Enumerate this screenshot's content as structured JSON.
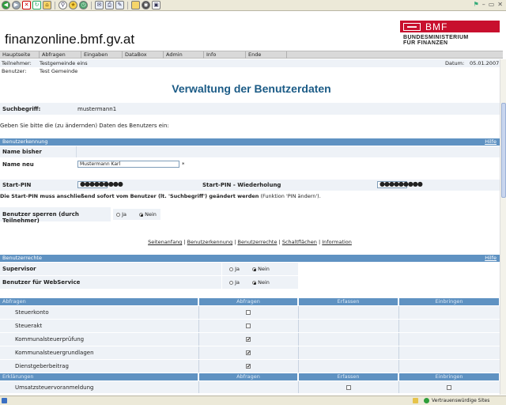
{
  "browser": {
    "toolbar_icons": [
      "back-icon",
      "forward-icon",
      "stop-icon",
      "refresh-icon",
      "home-icon",
      "search-icon",
      "favorites-icon",
      "history-icon",
      "mail-icon",
      "print-icon",
      "edit-icon",
      "folder-icon",
      "media-icon",
      "messenger-icon"
    ],
    "status_text": "Vertrauenswürdige Sites"
  },
  "header": {
    "site_title": "finanzonline.bmf.gv.at",
    "logo_short": "BMF",
    "logo_line1": "BUNDESMINISTERIUM",
    "logo_line2": "FÜR FINANZEN"
  },
  "nav": [
    "Hauptseite",
    "Abfragen",
    "Eingaben",
    "DataBox",
    "Admin",
    "Info",
    "Ende"
  ],
  "info": {
    "teilnehmer_label": "Teilnehmer:",
    "teilnehmer_value": "Testgemeinde eins",
    "benutzer_label": "Benutzer:",
    "benutzer_value": "Test Gemeinde",
    "datum_label": "Datum:",
    "datum_value": "05.01.2007"
  },
  "page_heading": "Verwaltung der Benutzerdaten",
  "search": {
    "label": "Suchbegriff:",
    "value": "mustermann1"
  },
  "instruction": "Geben Sie bitte die (zu ändernden) Daten des Benutzers ein:",
  "sections": {
    "benutzerkennung": "Benutzerkennung",
    "hilfe": "Hilfe",
    "benutzerrechte": "Benutzerrechte"
  },
  "name": {
    "bisher_label": "Name bisher",
    "neu_label": "Name neu",
    "neu_value": "Mustermann Karl",
    "required": "*"
  },
  "pin": {
    "start_label": "Start-PIN",
    "start_value": "●●●●●●●●●",
    "repeat_label": "Start-PIN - Wiederholung",
    "repeat_value": "●●●●●●●●●",
    "note_bold": "Die Start-PIN muss anschließend sofort vom Benutzer (lt. 'Suchbegriff') geändert werden",
    "note_normal": "(Funktion 'PIN ändern')."
  },
  "sperren": {
    "label": "Benutzer sperren (durch Teilnehmer)",
    "ja": "Ja",
    "nein": "Nein",
    "selected": "Nein"
  },
  "links": {
    "items": [
      "Seitenanfang",
      "Benutzerkennung",
      "Benutzerrechte",
      "Schaltflächen",
      "Information"
    ],
    "sep": "|"
  },
  "rechte": [
    {
      "label": "Supervisor",
      "ja": "Ja",
      "nein": "Nein",
      "selected": "Nein"
    },
    {
      "label": "Benutzer für WebService",
      "ja": "Ja",
      "nein": "Nein",
      "selected": "Nein"
    }
  ],
  "table": {
    "group1": {
      "title": "Abfragen",
      "cols": [
        "Abfragen",
        "Erfassen",
        "Einbringen"
      ]
    },
    "rows1": [
      {
        "label": "Steuerkonto",
        "abfragen": false
      },
      {
        "label": "Steuerakt",
        "abfragen": false
      },
      {
        "label": "Kommunalsteuerprüfung",
        "abfragen": true
      },
      {
        "label": "Kommunalsteuergrundlagen",
        "abfragen": true
      },
      {
        "label": "Dienstgeberbeitrag",
        "abfragen": true
      }
    ],
    "group2": {
      "title": "Erklärungen",
      "cols": [
        "Abfragen",
        "Erfassen",
        "Einbringen"
      ]
    },
    "rows2": [
      {
        "label": "Umsatzsteuervoranmeldung",
        "erfassen": false,
        "einbringen": false
      }
    ],
    "check_mark": "✔"
  }
}
